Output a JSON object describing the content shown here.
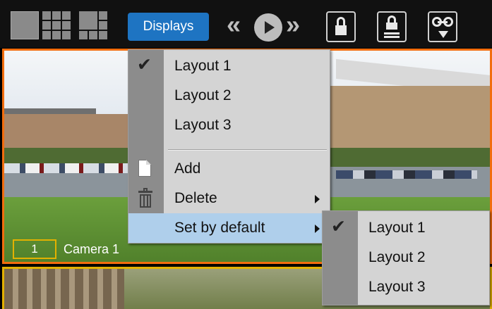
{
  "toolbar": {
    "layout_buttons": [
      "single-view-icon",
      "grid-3x3-icon",
      "mixed-grid-icon"
    ],
    "displays_label": "Displays",
    "nav_prev_glyph": "«",
    "nav_next_glyph": "»",
    "tools": [
      "lock-icon",
      "lock-save-icon",
      "archive-download-icon"
    ],
    "accent": "#1e74c2"
  },
  "camera1": {
    "number": "1",
    "name": "Camera 1",
    "border_color": "#f26d0e",
    "number_border_color": "#e3b100"
  },
  "camera2": {
    "border_color": "#e3b100"
  },
  "displays_menu": {
    "items": [
      {
        "label": "Layout 1",
        "checked": true
      },
      {
        "label": "Layout 2",
        "checked": false
      },
      {
        "label": "Layout 3",
        "checked": false
      }
    ],
    "actions": [
      {
        "label": "Add",
        "icon": "document-icon"
      },
      {
        "label": "Delete",
        "icon": "trash-icon",
        "submenu": true
      },
      {
        "label": "Set by default",
        "submenu": true,
        "highlighted": true
      }
    ],
    "check_glyph": "✔"
  },
  "default_submenu": {
    "items": [
      {
        "label": "Layout 1",
        "checked": true
      },
      {
        "label": "Layout 2",
        "checked": false
      },
      {
        "label": "Layout 3",
        "checked": false
      }
    ],
    "highlight_color": "#afcfeb"
  }
}
